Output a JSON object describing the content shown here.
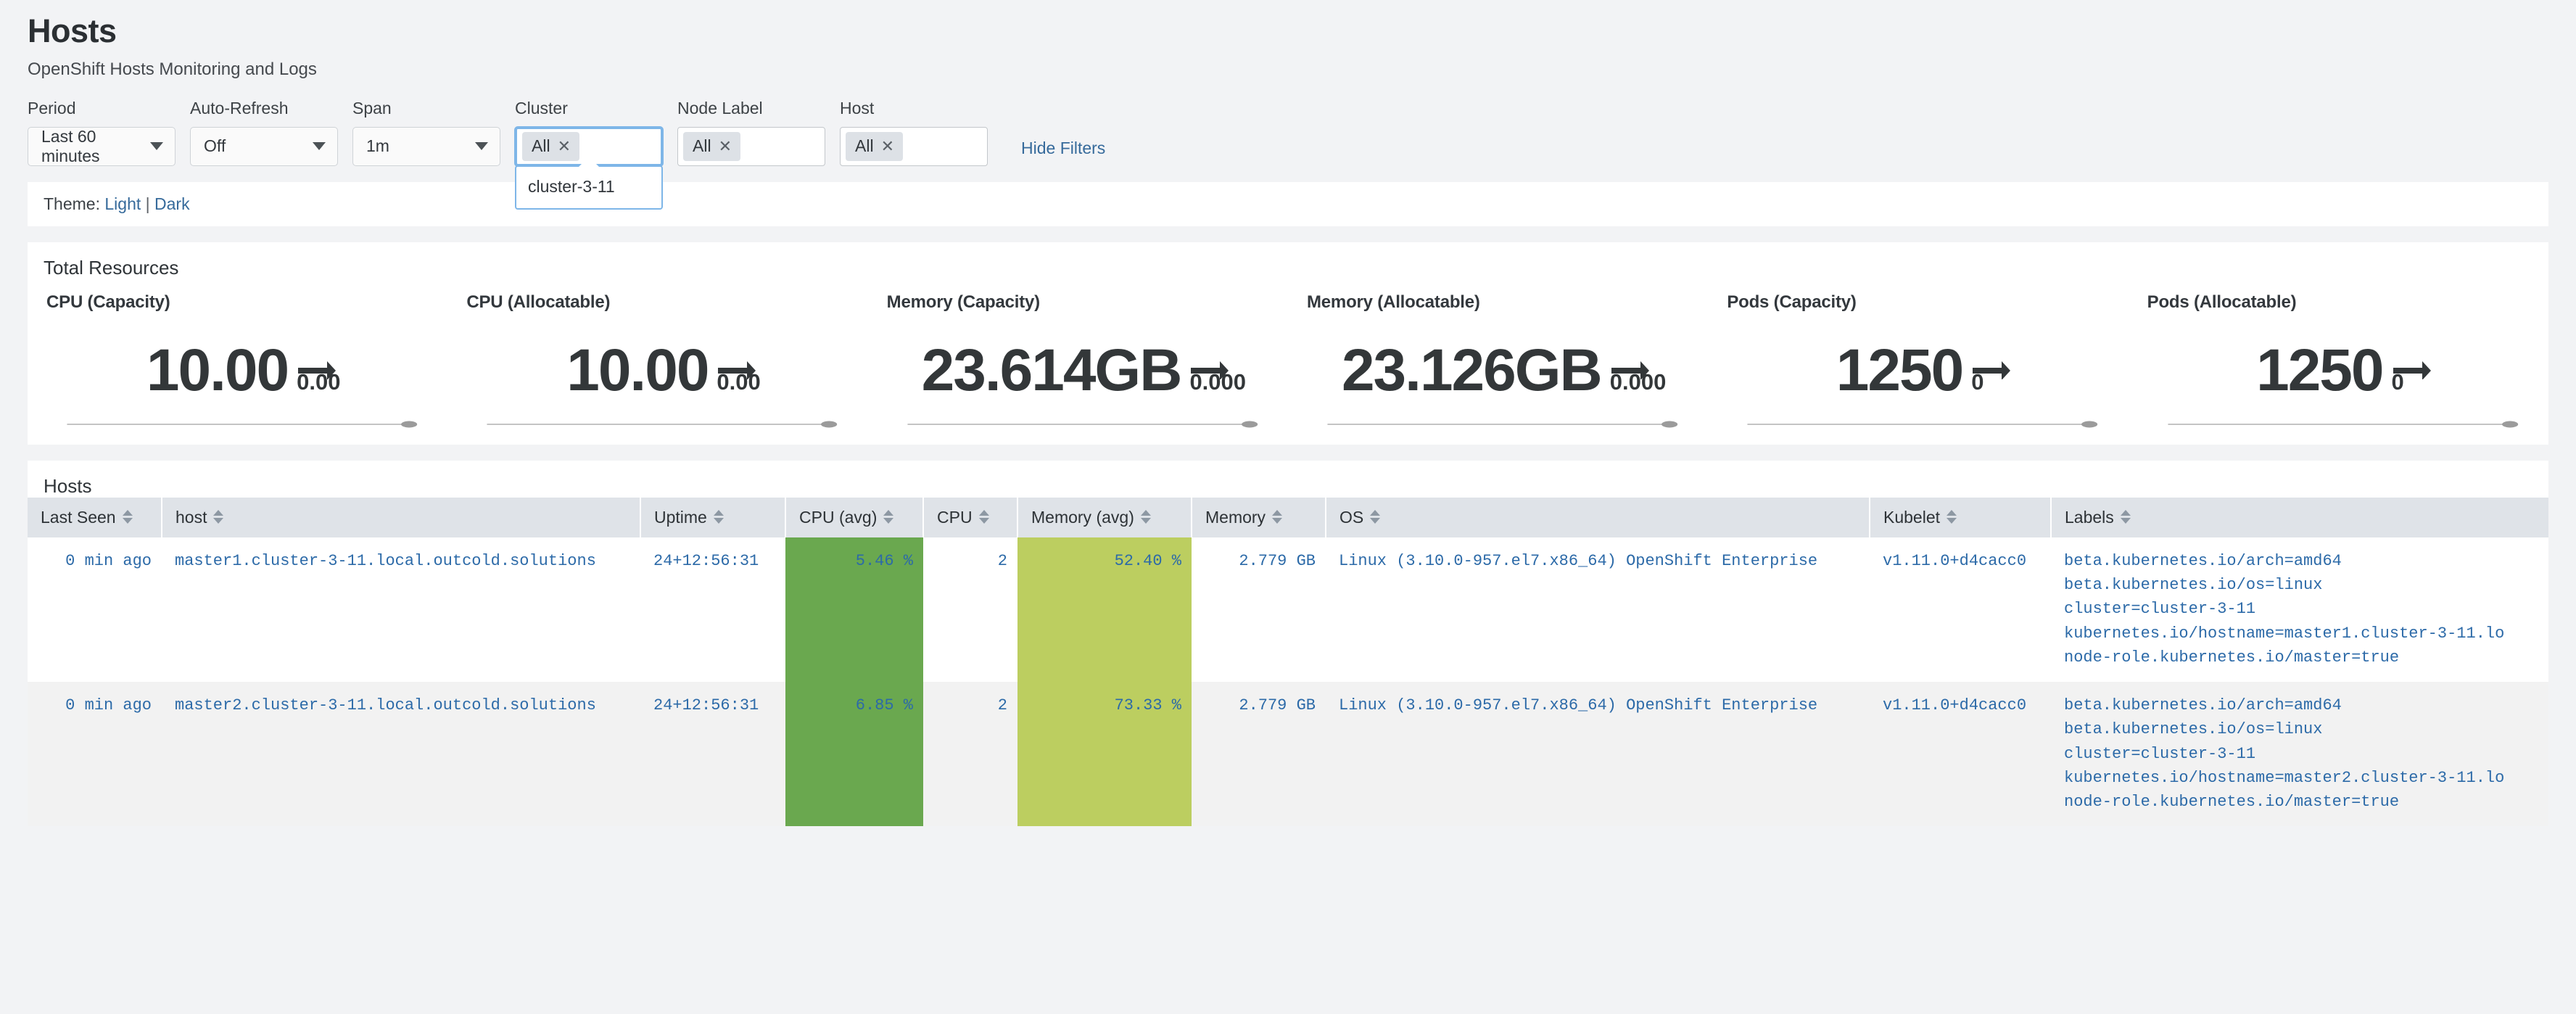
{
  "header": {
    "title": "Hosts",
    "subtitle": "OpenShift Hosts Monitoring and Logs"
  },
  "filters": {
    "period": {
      "label": "Period",
      "value": "Last 60 minutes"
    },
    "autorefresh": {
      "label": "Auto-Refresh",
      "value": "Off"
    },
    "span": {
      "label": "Span",
      "value": "1m"
    },
    "cluster": {
      "label": "Cluster",
      "chip": "All",
      "chip_remove": "✕",
      "dropdown_option": "cluster-3-11"
    },
    "node_label": {
      "label": "Node Label",
      "chip": "All",
      "chip_remove": "✕"
    },
    "host": {
      "label": "Host",
      "chip": "All",
      "chip_remove": "✕"
    },
    "hide_filters": "Hide Filters"
  },
  "theme": {
    "prefix": "Theme:",
    "light": "Light",
    "separator": "|",
    "dark": "Dark"
  },
  "total_resources": {
    "panel_title": "Total Resources",
    "cards": [
      {
        "title": "CPU (Capacity)",
        "value": "10.00",
        "trend_icon": "arrow-right-icon",
        "delta": "0.00"
      },
      {
        "title": "CPU (Allocatable)",
        "value": "10.00",
        "trend_icon": "arrow-right-icon",
        "delta": "0.00"
      },
      {
        "title": "Memory (Capacity)",
        "value": "23.614GB",
        "trend_icon": "arrow-right-icon",
        "delta": "0.000"
      },
      {
        "title": "Memory (Allocatable)",
        "value": "23.126GB",
        "trend_icon": "arrow-right-icon",
        "delta": "0.000"
      },
      {
        "title": "Pods (Capacity)",
        "value": "1250",
        "trend_icon": "arrow-right-icon",
        "delta": "0"
      },
      {
        "title": "Pods (Allocatable)",
        "value": "1250",
        "trend_icon": "arrow-right-icon",
        "delta": "0"
      }
    ]
  },
  "hosts_table": {
    "panel_title": "Hosts",
    "columns": [
      "Last Seen",
      "host",
      "Uptime",
      "CPU (avg)",
      "CPU",
      "Memory (avg)",
      "Memory",
      "OS",
      "Kubelet",
      "Labels"
    ],
    "rows": [
      {
        "last_seen": "0 min ago",
        "host": "master1.cluster-3-11.local.outcold.solutions",
        "uptime": "24+12:56:31",
        "cpu_avg": "5.46 %",
        "cpu": "2",
        "memory_avg": "52.40 %",
        "memory": "2.779 GB",
        "os": "Linux (3.10.0-957.el7.x86_64) OpenShift Enterprise",
        "kubelet": "v1.11.0+d4cacc0",
        "labels": [
          "beta.kubernetes.io/arch=amd64",
          "beta.kubernetes.io/os=linux",
          "cluster=cluster-3-11",
          "kubernetes.io/hostname=master1.cluster-3-11.lo",
          "node-role.kubernetes.io/master=true"
        ]
      },
      {
        "last_seen": "0 min ago",
        "host": "master2.cluster-3-11.local.outcold.solutions",
        "uptime": "24+12:56:31",
        "cpu_avg": "6.85 %",
        "cpu": "2",
        "memory_avg": "73.33 %",
        "memory": "2.779 GB",
        "os": "Linux (3.10.0-957.el7.x86_64) OpenShift Enterprise",
        "kubelet": "v1.11.0+d4cacc0",
        "labels": [
          "beta.kubernetes.io/arch=amd64",
          "beta.kubernetes.io/os=linux",
          "cluster=cluster-3-11",
          "kubernetes.io/hostname=master2.cluster-3-11.lo",
          "node-role.kubernetes.io/master=true"
        ]
      }
    ]
  },
  "colors": {
    "link": "#2c6aa8",
    "accent": "#366a9b",
    "cpu_avg_cell": "#6aa84f",
    "mem_avg_cell": "#bcce60",
    "header_row": "#dfe3e8",
    "focus_border": "#7eb6e8"
  }
}
